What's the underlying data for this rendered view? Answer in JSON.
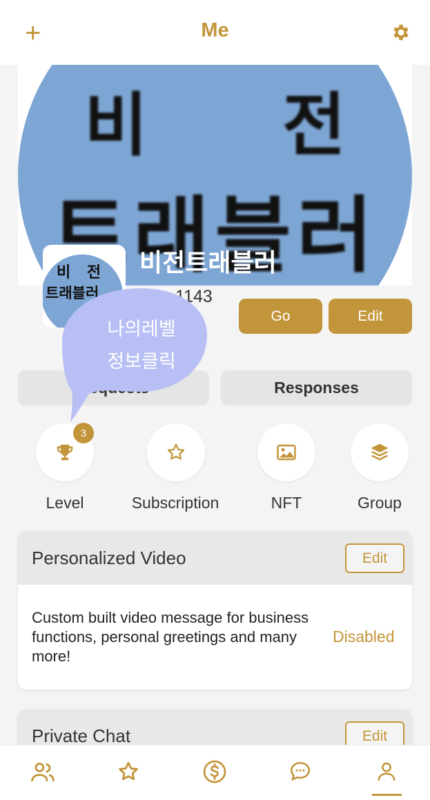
{
  "header": {
    "title": "Me",
    "add_icon": "plus-icon",
    "settings_icon": "gear-icon"
  },
  "cover": {
    "line1": "비 전",
    "line2": "트래블러"
  },
  "avatar": {
    "line1": "비 전",
    "line2": "트래블러"
  },
  "profile": {
    "username": "비전트래블러",
    "user_id": "1143"
  },
  "actions": {
    "go_label": "Go",
    "edit_label": "Edit"
  },
  "tabs": [
    {
      "label": "Requests"
    },
    {
      "label": "Responses"
    }
  ],
  "bubble": {
    "line1": "나의레벨",
    "line2": "정보클릭"
  },
  "shortcuts": [
    {
      "label": "Level",
      "icon": "trophy-icon",
      "badge": "3"
    },
    {
      "label": "Subscription",
      "icon": "star-icon"
    },
    {
      "label": "NFT",
      "icon": "image-icon"
    },
    {
      "label": "Group",
      "icon": "layers-icon"
    }
  ],
  "cards": [
    {
      "title": "Personalized Video",
      "edit_label": "Edit",
      "description": "Custom built video message for business functions, personal greetings and many more!",
      "status": "Disabled"
    },
    {
      "title": "Private Chat",
      "edit_label": "Edit"
    }
  ],
  "bottom_nav": [
    {
      "icon": "people-icon"
    },
    {
      "icon": "star-icon"
    },
    {
      "icon": "dollar-icon"
    },
    {
      "icon": "chat-icon"
    },
    {
      "icon": "user-icon",
      "active": true
    }
  ],
  "colors": {
    "accent": "#c3953a",
    "cover_bg": "#7ea6d4",
    "bubble": "#b8bff5"
  }
}
